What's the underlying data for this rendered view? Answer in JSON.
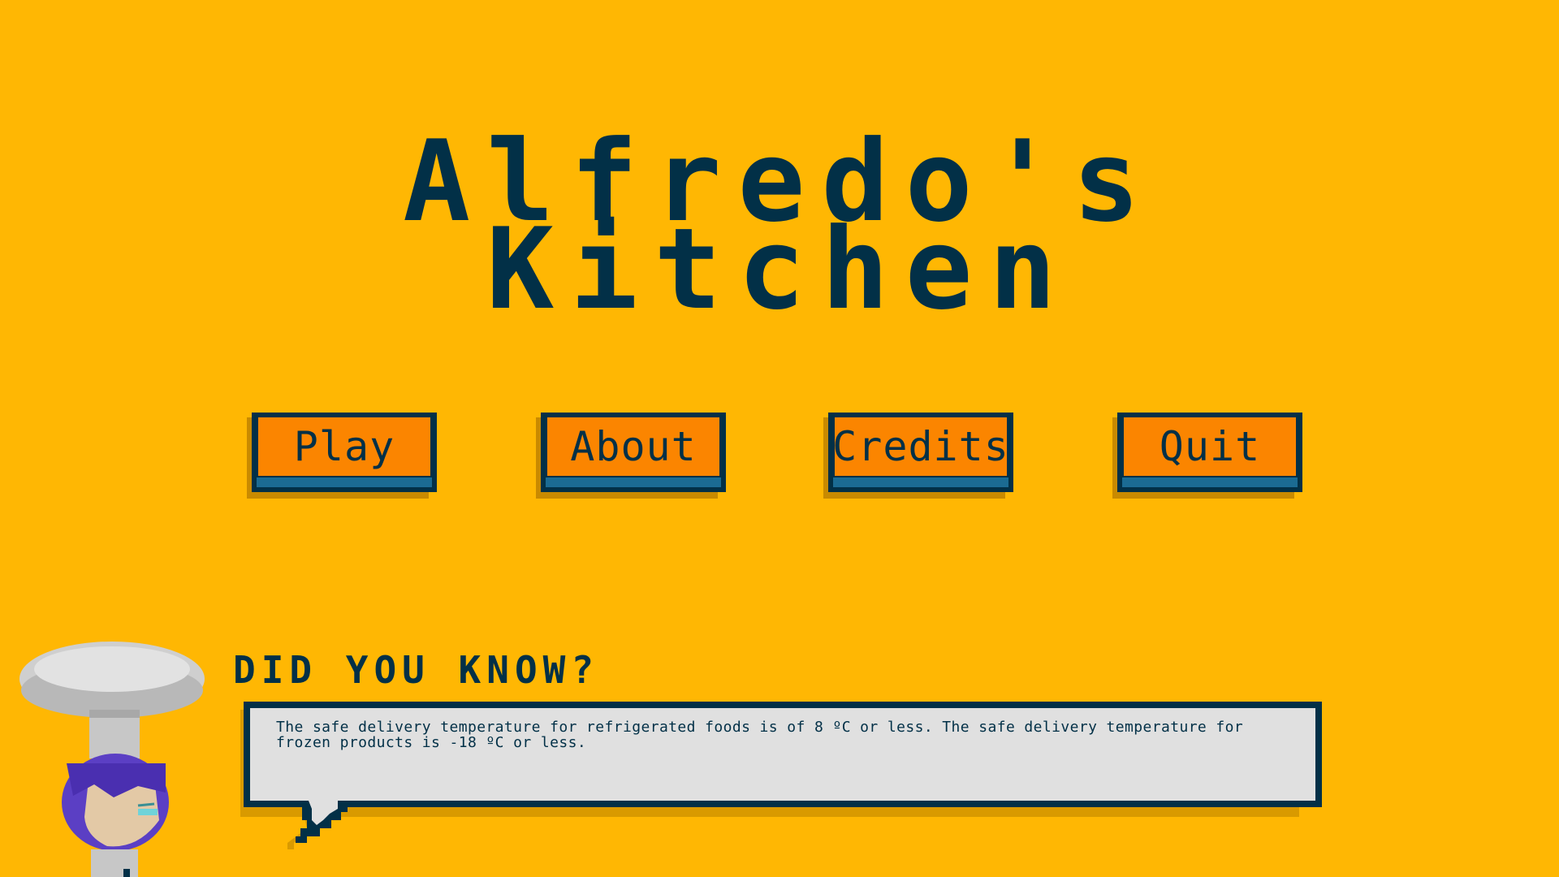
{
  "title": {
    "line1": "Alfredo's",
    "line2": "Kitchen"
  },
  "menu": {
    "play": "Play",
    "about": "About",
    "credits": "Credits",
    "quit": "Quit"
  },
  "tip": {
    "heading": "DID YOU KNOW?",
    "text": "The safe delivery temperature for refrigerated foods is of 8 ºC or less. The safe delivery temperature for frozen products is -18 ºC or less."
  },
  "colors": {
    "background": "#FFB703",
    "title": "#023047",
    "button_face": "#FB8500",
    "button_lip": "#1B6B93",
    "bubble": "#E0E0E0",
    "chef_hair": "#5B3FC4",
    "chef_hat": "#BDBDBD"
  },
  "icons": {
    "chef": "chef-character-icon",
    "tail": "speech-bubble-tail-icon"
  }
}
